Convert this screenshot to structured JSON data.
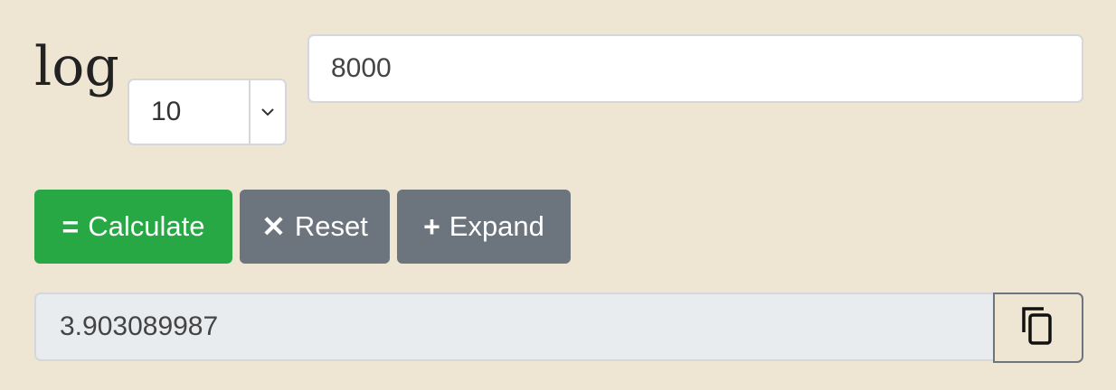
{
  "label": "log",
  "base_select": {
    "value": "10",
    "icon": "chevron-down-icon"
  },
  "number_input": {
    "value": "8000"
  },
  "buttons": {
    "calculate": {
      "glyph": "=",
      "label": "Calculate",
      "color": "#28a745"
    },
    "reset": {
      "glyph": "✕",
      "label": "Reset",
      "color": "#6c757d"
    },
    "expand": {
      "glyph": "+",
      "label": "Expand",
      "color": "#6c757d"
    }
  },
  "result": {
    "value": "3.903089987",
    "copy_icon": "copy-icon"
  }
}
